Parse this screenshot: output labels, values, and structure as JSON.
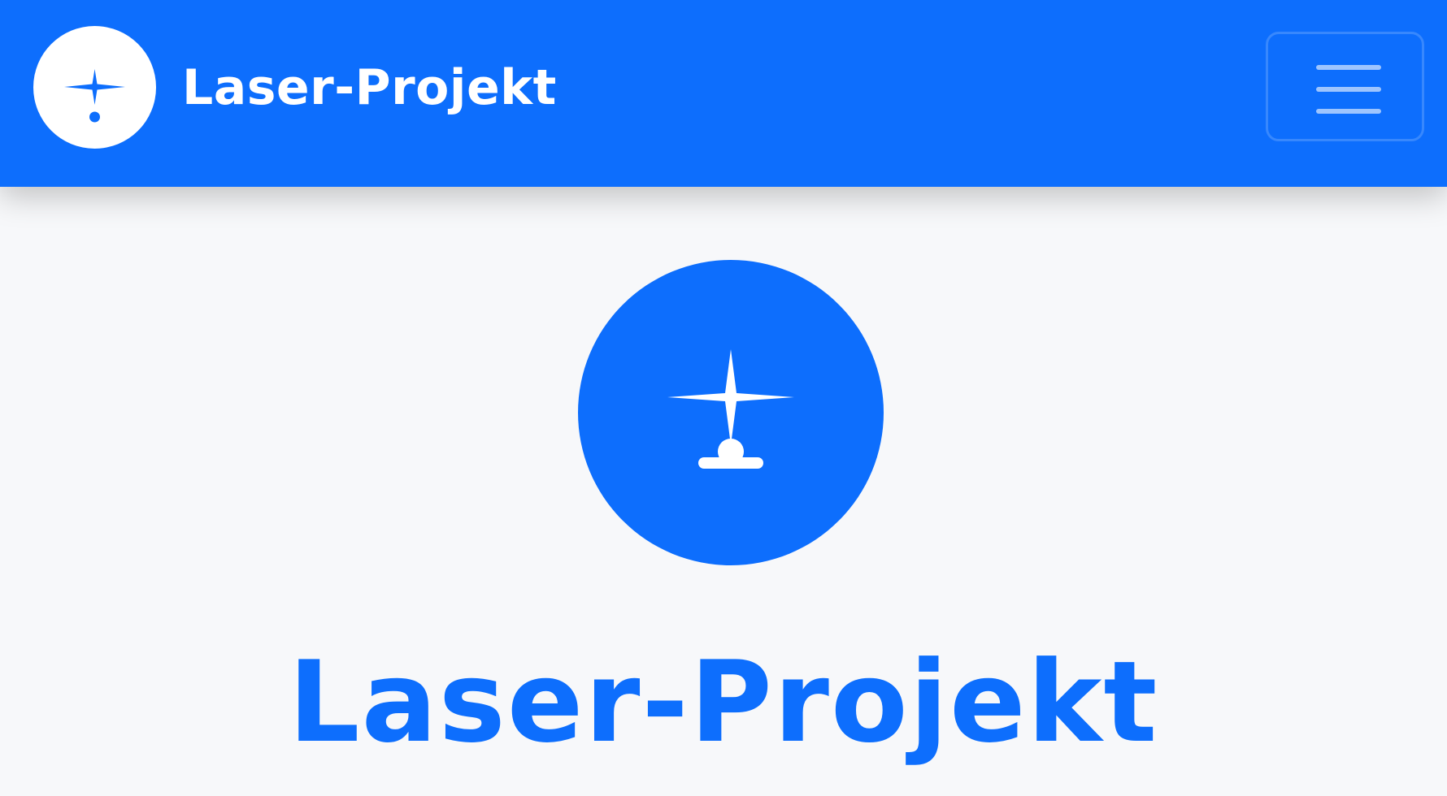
{
  "header": {
    "brand_name": "Laser-Projekt",
    "brand_logo_icon": "laser-star-icon",
    "menu_icon": "hamburger-menu-icon"
  },
  "hero": {
    "logo_icon": "laser-engraver-icon",
    "title": "Laser-Projekt"
  },
  "colors": {
    "primary": "#0d6efd",
    "background": "#f7f8fa",
    "on_primary": "#ffffff"
  }
}
